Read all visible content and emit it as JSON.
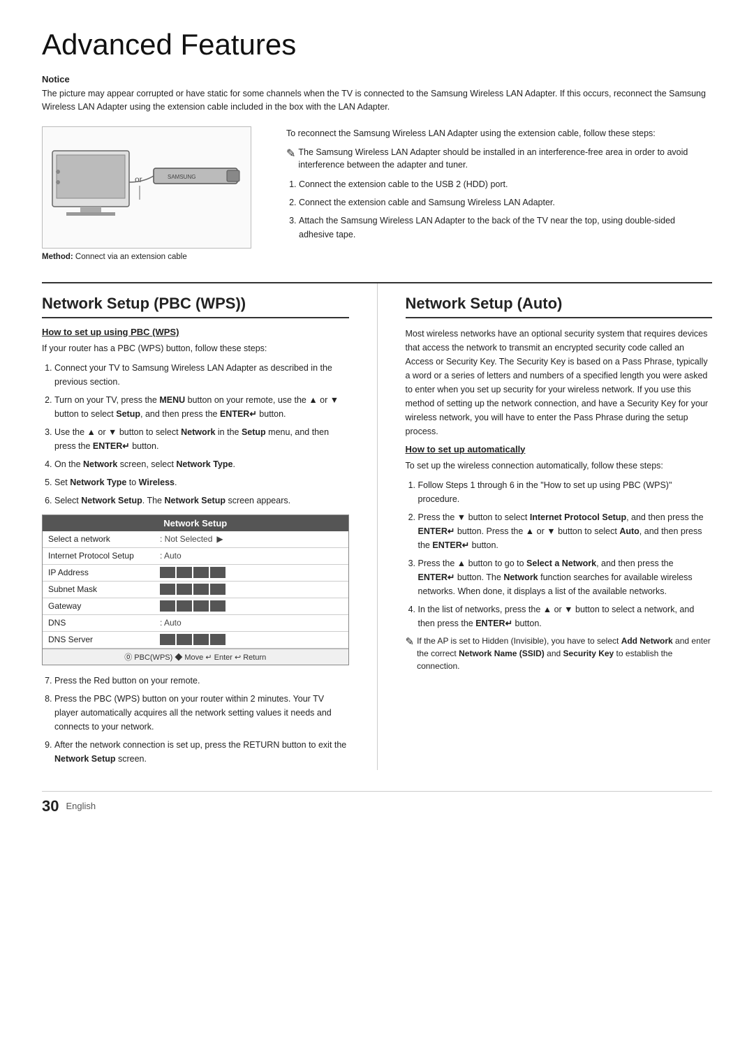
{
  "page": {
    "title": "Advanced Features",
    "page_number": "30",
    "language": "English"
  },
  "notice": {
    "label": "Notice",
    "text": "The picture may appear corrupted or have static for some channels when the TV is connected to the Samsung Wireless LAN Adapter. If this occurs, reconnect the Samsung Wireless LAN Adapter using the extension cable included in the box with the LAN Adapter."
  },
  "reconnect_instructions": {
    "intro": "To reconnect the Samsung Wireless LAN Adapter using the extension cable, follow these steps:",
    "note": "The Samsung Wireless LAN Adapter should be installed in an interference-free area in order to avoid interference between the adapter and tuner.",
    "steps": [
      "Connect the extension cable to the USB 2 (HDD) port.",
      "Connect the extension cable and Samsung Wireless LAN Adapter.",
      "Attach the Samsung Wireless LAN Adapter to the back of the TV near the top, using double-sided adhesive tape."
    ]
  },
  "diagram": {
    "method_label": "Method:",
    "method_text": "Connect via an extension cable"
  },
  "pbc_section": {
    "title": "Network Setup (PBC (WPS))",
    "subsection_title": "How to set up using PBC (WPS)",
    "intro": "If your router has a PBC (WPS) button, follow these steps:",
    "steps": [
      "Connect your TV to Samsung Wireless LAN Adapter as described in the previous section.",
      "Turn on your TV, press the MENU button on your remote, use the ▲ or ▼ button to select Setup, and then press the ENTER↵ button.",
      "Use the ▲ or ▼ button to select Network in the Setup menu, and then press the ENTER↵ button.",
      "On the Network screen, select Network Type.",
      "Set Network Type to Wireless.",
      "Select Network Setup. The Network Setup screen appears."
    ],
    "steps_after_box": [
      "Press the Red button on your remote.",
      "Press the PBC (WPS) button on your router within 2 minutes. Your TV player automatically acquires all the network setting values it needs and connects to your network.",
      "After the network connection is set up, press the RETURN button to exit the Network Setup screen."
    ]
  },
  "network_setup_box": {
    "header": "Network Setup",
    "rows": [
      {
        "label": "Select a network",
        "value": "Not Selected",
        "has_arrow": true
      },
      {
        "label": "Internet Protocol Setup",
        "value": "Auto",
        "has_arrow": false
      },
      {
        "label": "IP Address",
        "value": "",
        "has_blocks": true
      },
      {
        "label": "Subnet Mask",
        "value": "",
        "has_blocks": true
      },
      {
        "label": "Gateway",
        "value": "",
        "has_blocks": true
      },
      {
        "label": "DNS",
        "value": "Auto",
        "has_arrow": false
      },
      {
        "label": "DNS Server",
        "value": "",
        "has_blocks": true
      }
    ],
    "footer": "⓪ PBC(WPS)   ◆ Move   ↵ Enter   ↩ Return"
  },
  "auto_section": {
    "title": "Network Setup (Auto)",
    "intro": "Most wireless networks have an optional security system that requires devices that access the network to transmit an encrypted security code called an Access or Security Key. The Security Key is based on a Pass Phrase, typically a word or a series of letters and numbers of a specified length you were asked to enter when you set up security for your wireless network. If you use this method of setting up the network connection, and have a Security Key for your wireless network, you will have to enter the Pass Phrase during the setup process.",
    "subsection_title": "How to set up automatically",
    "auto_intro": "To set up the wireless connection automatically, follow these steps:",
    "steps": [
      "Follow Steps 1 through 6 in the \"How to set up using PBC (WPS)\" procedure.",
      "Press the ▼ button to select Internet Protocol Setup, and then press the ENTER↵ button. Press the ▲ or ▼ button to select Auto, and then press the ENTER↵ button.",
      "Press the ▲ button to go to Select a Network, and then press the ENTER↵ button. The Network function searches for available wireless networks. When done, it displays a list of the available networks.",
      "In the list of networks, press the ▲ or ▼ button to select a network, and then press the ENTER↵ button."
    ],
    "note": "If the AP is set to Hidden (Invisible), you have to select Add Network and enter the correct Network Name (SSID) and Security Key to establish the connection."
  }
}
